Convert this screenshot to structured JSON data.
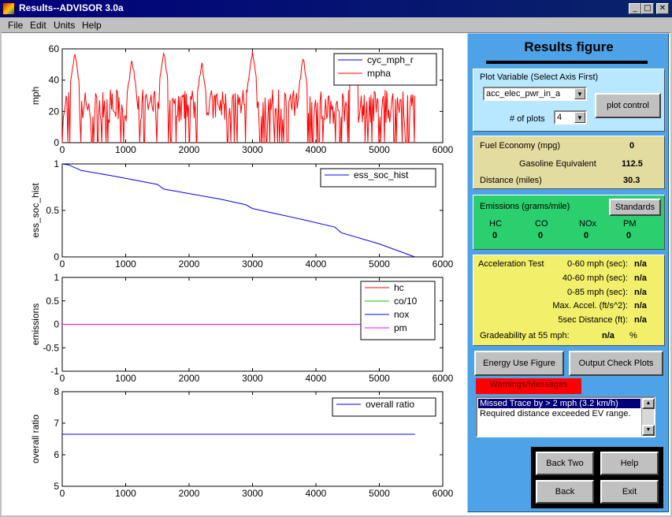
{
  "window": {
    "title": "Results--ADVISOR 3.0a",
    "min": "_",
    "max": "□",
    "close": "✕"
  },
  "menu": [
    "File",
    "Edit",
    "Units",
    "Help"
  ],
  "panel": {
    "title": "Results figure",
    "plot_variable": {
      "label": "Plot Variable (Select Axis First)",
      "selected": "acc_elec_pwr_in_a",
      "plots_label": "# of plots",
      "plots_value": "4",
      "plot_control": "plot control"
    },
    "fuel": {
      "fe_label": "Fuel Economy (mpg)",
      "fe_value": "0",
      "ge_label": "Gasoline Equivalent",
      "ge_value": "112.5",
      "dist_label": "Distance (miles)",
      "dist_value": "30.3"
    },
    "emissions": {
      "title": "Emissions (grams/mile)",
      "standards": "Standards",
      "items": [
        {
          "name": "HC",
          "value": "0"
        },
        {
          "name": "CO",
          "value": "0"
        },
        {
          "name": "NOx",
          "value": "0"
        },
        {
          "name": "PM",
          "value": "0"
        }
      ]
    },
    "accel": {
      "title": "Acceleration Test",
      "rows": [
        {
          "label": "0-60 mph (sec):",
          "value": "n/a"
        },
        {
          "label": "40-60 mph (sec):",
          "value": "n/a"
        },
        {
          "label": "0-85 mph (sec):",
          "value": "n/a"
        },
        {
          "label": "Max. Accel. (ft/s^2):",
          "value": "n/a"
        },
        {
          "label": "5sec Distance (ft):",
          "value": "n/a"
        }
      ],
      "grade_label": "Gradeability at 55 mph:",
      "grade_value": "n/a",
      "grade_unit": "%"
    },
    "energy_use": "Energy Use Figure",
    "output_check": "Output Check Plots",
    "warnings": {
      "title": "Warnings/Messages",
      "items": [
        "Missed Trace by > 2 mph (3.2 km/h)",
        "Required distance exceeded EV range."
      ]
    },
    "nav": {
      "back_two": "Back Two",
      "help": "Help",
      "back": "Back",
      "exit": "Exit"
    }
  },
  "colors": {
    "blue": "#0000ff",
    "red": "#ff0000",
    "green": "#00cc00",
    "magenta": "#ff00ff",
    "panel": "#4ea3e8"
  },
  "chart_data": [
    {
      "type": "line",
      "ylabel": "mph",
      "xlim": [
        0,
        6000
      ],
      "ylim": [
        0,
        60
      ],
      "xticks": [
        "0",
        "1000",
        "2000",
        "3000",
        "4000",
        "5000",
        "6000"
      ],
      "yticks": [
        "0",
        "20",
        "40",
        "60"
      ],
      "series": [
        {
          "name": "cyc_mph_r",
          "color": "#0000ff"
        },
        {
          "name": "mpha",
          "color": "#ff0000"
        }
      ],
      "peaks": [
        {
          "x": 200,
          "y": 56
        },
        {
          "x": 1100,
          "y": 52
        },
        {
          "x": 1600,
          "y": 57
        },
        {
          "x": 2200,
          "y": 50
        },
        {
          "x": 3000,
          "y": 57
        },
        {
          "x": 3800,
          "y": 53
        },
        {
          "x": 4600,
          "y": 55
        }
      ],
      "duration": 5560
    },
    {
      "type": "line",
      "ylabel": "ess_soc_hist",
      "xlim": [
        0,
        6000
      ],
      "ylim": [
        0,
        1
      ],
      "xticks": [
        "0",
        "1000",
        "2000",
        "3000",
        "4000",
        "5000",
        "6000"
      ],
      "yticks": [
        "0",
        "0.5",
        "1"
      ],
      "series": [
        {
          "name": "ess_soc_hist",
          "color": "#0000ff",
          "x": [
            0,
            100,
            300,
            800,
            1500,
            1600,
            2500,
            2900,
            3000,
            3800,
            4300,
            4400,
            5000,
            5560
          ],
          "y": [
            1.0,
            0.99,
            0.93,
            0.87,
            0.78,
            0.73,
            0.62,
            0.56,
            0.52,
            0.4,
            0.32,
            0.26,
            0.14,
            0.0
          ]
        }
      ]
    },
    {
      "type": "line",
      "ylabel": "emissions",
      "xlim": [
        0,
        6000
      ],
      "ylim": [
        -1,
        1
      ],
      "xticks": [
        "0",
        "1000",
        "2000",
        "3000",
        "4000",
        "5000",
        "6000"
      ],
      "yticks": [
        "-1",
        "-0.5",
        "0",
        "0.5",
        "1"
      ],
      "series": [
        {
          "name": "hc",
          "color": "#ff0000",
          "x": [
            0,
            5560
          ],
          "y": [
            0,
            0
          ]
        },
        {
          "name": "co/10",
          "color": "#00cc00",
          "x": [
            0,
            5560
          ],
          "y": [
            0,
            0
          ]
        },
        {
          "name": "nox",
          "color": "#0000ff",
          "x": [
            0,
            5560
          ],
          "y": [
            0,
            0
          ]
        },
        {
          "name": "pm",
          "color": "#ff00ff",
          "x": [
            0,
            5560
          ],
          "y": [
            0,
            0
          ]
        }
      ]
    },
    {
      "type": "line",
      "ylabel": "overall ratio",
      "xlim": [
        0,
        6000
      ],
      "ylim": [
        5,
        8
      ],
      "xticks": [
        "0",
        "1000",
        "2000",
        "3000",
        "4000",
        "5000",
        "6000"
      ],
      "yticks": [
        "5",
        "6",
        "7",
        "8"
      ],
      "series": [
        {
          "name": "overall ratio",
          "color": "#0000ff",
          "x": [
            0,
            5560
          ],
          "y": [
            6.65,
            6.65
          ]
        }
      ]
    }
  ]
}
